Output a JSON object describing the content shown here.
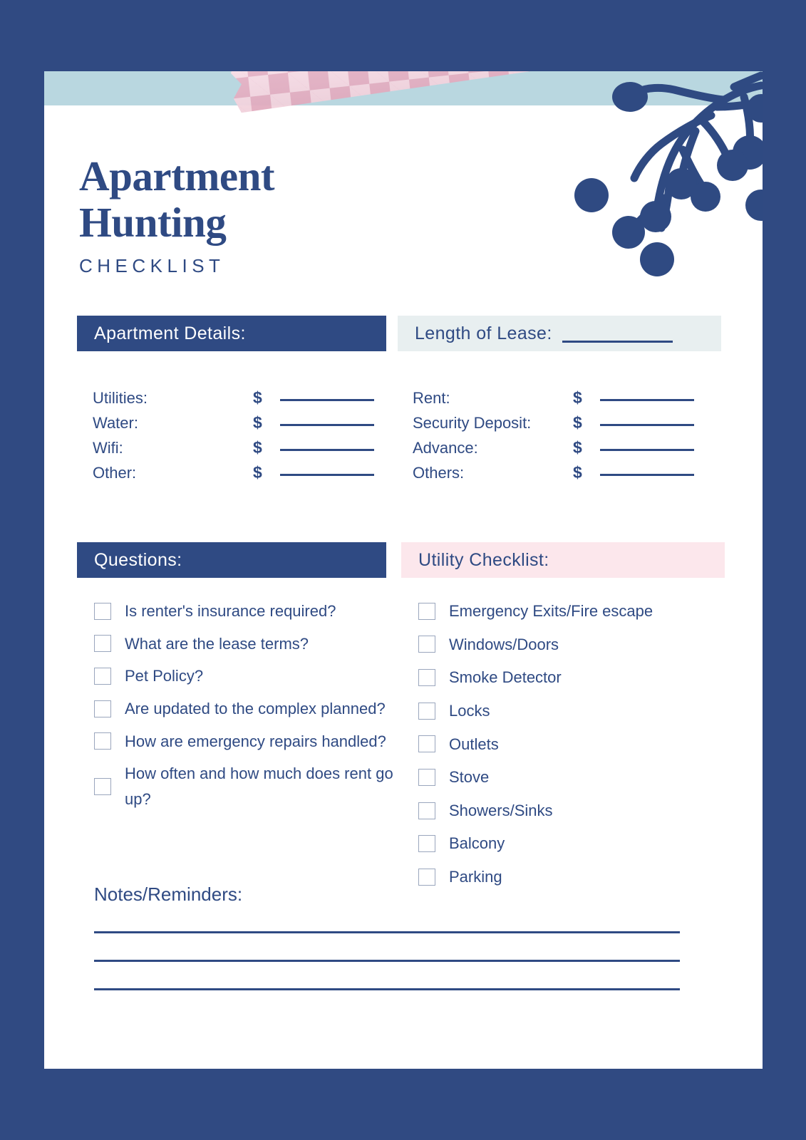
{
  "theme": {
    "navy": "#2f4a82",
    "border_navy": "#304a82",
    "light_blue_band": "#b9d7e0",
    "blue_gray_bar": "#e8eff0",
    "pink_bar": "#fce7ec",
    "tape_pink_dark": "#e9b4c6",
    "tape_pink_light": "#fbdfe8",
    "checkbox_border": "#9aa6bd",
    "card_background": "#ffffff"
  },
  "header": {
    "title_line_1": "Apartment",
    "title_line_2": "Hunting",
    "subtitle": "CHECKLIST"
  },
  "decorations": {
    "washi_tape": "washi-tape-checkered-pink",
    "branch": "navy-branch-with-bulb-tips"
  },
  "sections": {
    "apartment_details": {
      "heading": "Apartment Details:",
      "fields": [
        {
          "label": "Utilities:",
          "currency": "$",
          "value": ""
        },
        {
          "label": "Water:",
          "currency": "$",
          "value": ""
        },
        {
          "label": "Wifi:",
          "currency": "$",
          "value": ""
        },
        {
          "label": "Other:",
          "currency": "$",
          "value": ""
        }
      ]
    },
    "length_of_lease": {
      "heading": "Length of Lease:",
      "value": "",
      "fields": [
        {
          "label": "Rent:",
          "currency": "$",
          "value": ""
        },
        {
          "label": "Security Deposit:",
          "currency": "$",
          "value": ""
        },
        {
          "label": "Advance:",
          "currency": "$",
          "value": ""
        },
        {
          "label": "Others:",
          "currency": "$",
          "value": ""
        }
      ]
    },
    "questions": {
      "heading": "Questions:",
      "items": [
        {
          "label": "Is renter's insurance required?",
          "checked": false
        },
        {
          "label": "What are the lease terms?",
          "checked": false
        },
        {
          "label": "Pet Policy?",
          "checked": false
        },
        {
          "label": "Are updated to the complex planned?",
          "checked": false
        },
        {
          "label": "How are emergency repairs handled?",
          "checked": false
        },
        {
          "label": "How often and how much does rent go up?",
          "checked": false
        }
      ]
    },
    "utility_checklist": {
      "heading": "Utility Checklist:",
      "items": [
        {
          "label": "Emergency Exits/Fire escape",
          "checked": false
        },
        {
          "label": "Windows/Doors",
          "checked": false
        },
        {
          "label": "Smoke Detector",
          "checked": false
        },
        {
          "label": "Locks",
          "checked": false
        },
        {
          "label": "Outlets",
          "checked": false
        },
        {
          "label": "Stove",
          "checked": false
        },
        {
          "label": "Showers/Sinks",
          "checked": false
        },
        {
          "label": "Balcony",
          "checked": false
        },
        {
          "label": "Parking",
          "checked": false
        }
      ]
    },
    "notes": {
      "heading": "Notes/Reminders:",
      "lines": [
        "",
        "",
        ""
      ]
    }
  }
}
